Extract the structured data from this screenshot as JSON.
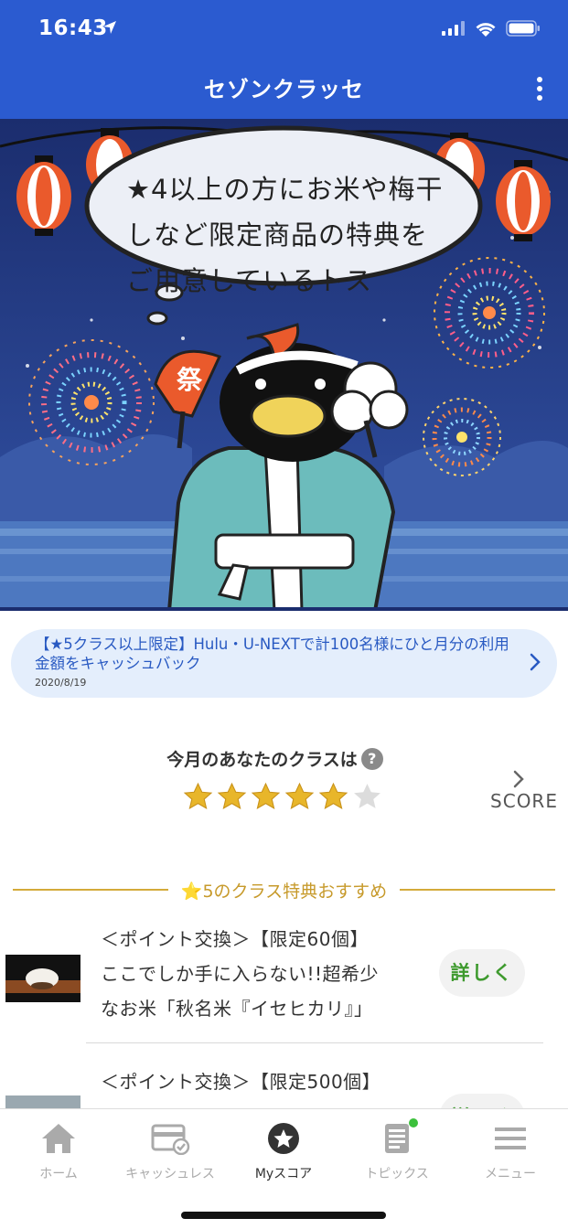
{
  "status_bar": {
    "time": "16:43"
  },
  "header": {
    "title": "セゾンクラッセ"
  },
  "banner": {
    "lines": [
      "★4以上の方にお米や梅干",
      "しなど限定商品の特典を",
      "ご用意しているトス"
    ],
    "fan_text": "祭"
  },
  "notice": {
    "text": "【★5クラス以上限定】Hulu・U-NEXTで計100名様にひと月分の利用金額をキャッシュバック",
    "date": "2020/8/19"
  },
  "class_section": {
    "label": "今月のあなたのクラスは",
    "help": "?",
    "stars_filled": 5,
    "stars_total": 6,
    "score_label": "SCORE"
  },
  "recommendations": {
    "heading": "⭐5のクラス特典おすすめ",
    "items": [
      {
        "lines": [
          "＜ポイント交換＞【限定60個】",
          "ここでしか手に入らない!!超希少",
          "なお米「秋名米『イセヒカリ』」"
        ],
        "button": "詳しく"
      },
      {
        "lines": [
          "＜ポイント交換＞【限定500個】"
        ],
        "button": "詳しく"
      }
    ]
  },
  "tabs": [
    {
      "label": "ホーム",
      "icon": "home-icon"
    },
    {
      "label": "キャッシュレス",
      "icon": "card-check-icon"
    },
    {
      "label": "Myスコア",
      "icon": "star-badge-icon",
      "active": true
    },
    {
      "label": "トピックス",
      "icon": "document-icon",
      "badge": true
    },
    {
      "label": "メニュー",
      "icon": "hamburger-icon"
    }
  ],
  "colors": {
    "header": "#2b5bd0",
    "star_gold": "#e8b62a",
    "accent_green": "#3e9a2e",
    "heading_gold": "#c79a2b",
    "notice_bg": "#e4eefc"
  }
}
